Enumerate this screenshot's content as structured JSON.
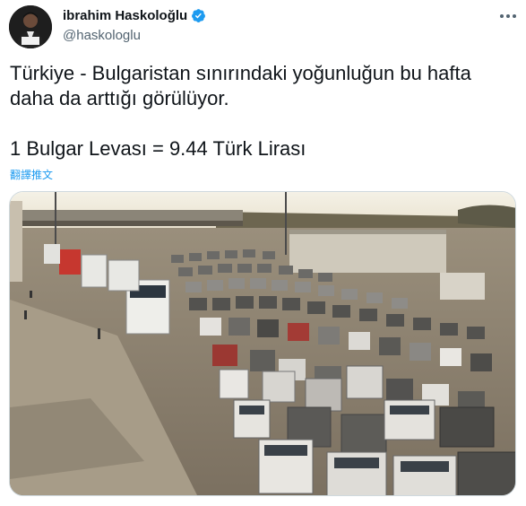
{
  "author": {
    "display_name": "ibrahim Haskoloğlu",
    "handle": "@haskologlu",
    "verified": true
  },
  "icons": {
    "verified": "verified-badge-icon",
    "more": "more-options-icon"
  },
  "tweet": {
    "line1": "Türkiye - Bulgaristan sınırındaki yoğunluğun bu hafta daha da arttığı görülüyor.",
    "line2": "1 Bulgar Levası = 9.44 Türk Lirası",
    "translate_label": "翻譯推文"
  },
  "media": {
    "description_kind": "photo"
  },
  "colors": {
    "accent": "#1d9bf0",
    "text_primary": "#0f1419",
    "text_secondary": "#536471"
  }
}
